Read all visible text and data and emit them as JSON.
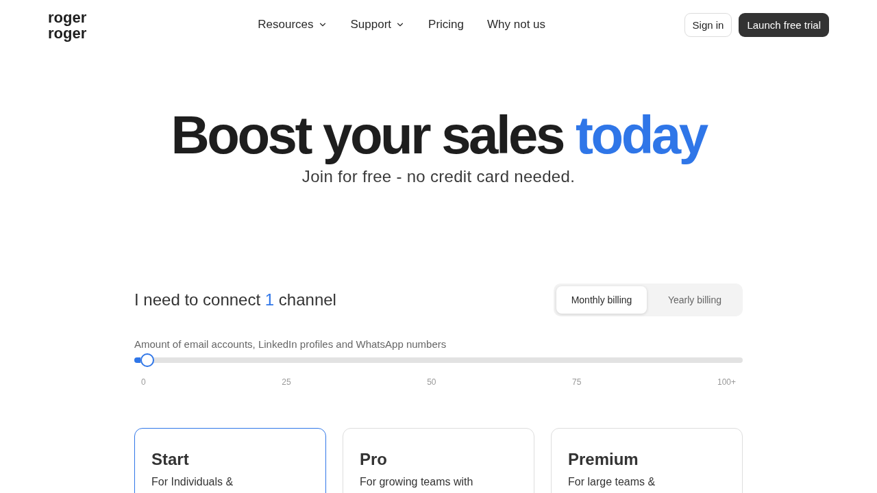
{
  "header": {
    "logo": [
      "roger",
      "roger"
    ],
    "nav": [
      {
        "label": "Resources",
        "kind": "dropdown"
      },
      {
        "label": "Support",
        "kind": "dropdown"
      },
      {
        "label": "Pricing",
        "kind": "link"
      },
      {
        "label": "Why not us",
        "kind": "link"
      }
    ],
    "sign_in": "Sign in",
    "cta": "Launch free trial"
  },
  "hero": {
    "title": "Boost your sales",
    "title_highlight": "today",
    "subtitle": "Join for free - no credit card needed."
  },
  "pricing": {
    "channels": {
      "prefix": "I need to connect",
      "count": "1",
      "suffix": "channel"
    },
    "billing": [
      {
        "label": "Monthly billing",
        "selected": true
      },
      {
        "label": "Yearly billing",
        "selected": false
      }
    ],
    "slider": {
      "label": "Amount of email accounts, LinkedIn profiles and WhatsApp numbers",
      "level": 0.01,
      "ticks": [
        "0",
        "25",
        "50",
        "75",
        "100+"
      ]
    },
    "plans": [
      {
        "name": "Start",
        "description": "For Individuals &",
        "selected": true
      },
      {
        "name": "Pro",
        "description": "For growing teams with",
        "selected": false
      },
      {
        "name": "Premium",
        "description": "For large teams &",
        "selected": false
      }
    ]
  }
}
